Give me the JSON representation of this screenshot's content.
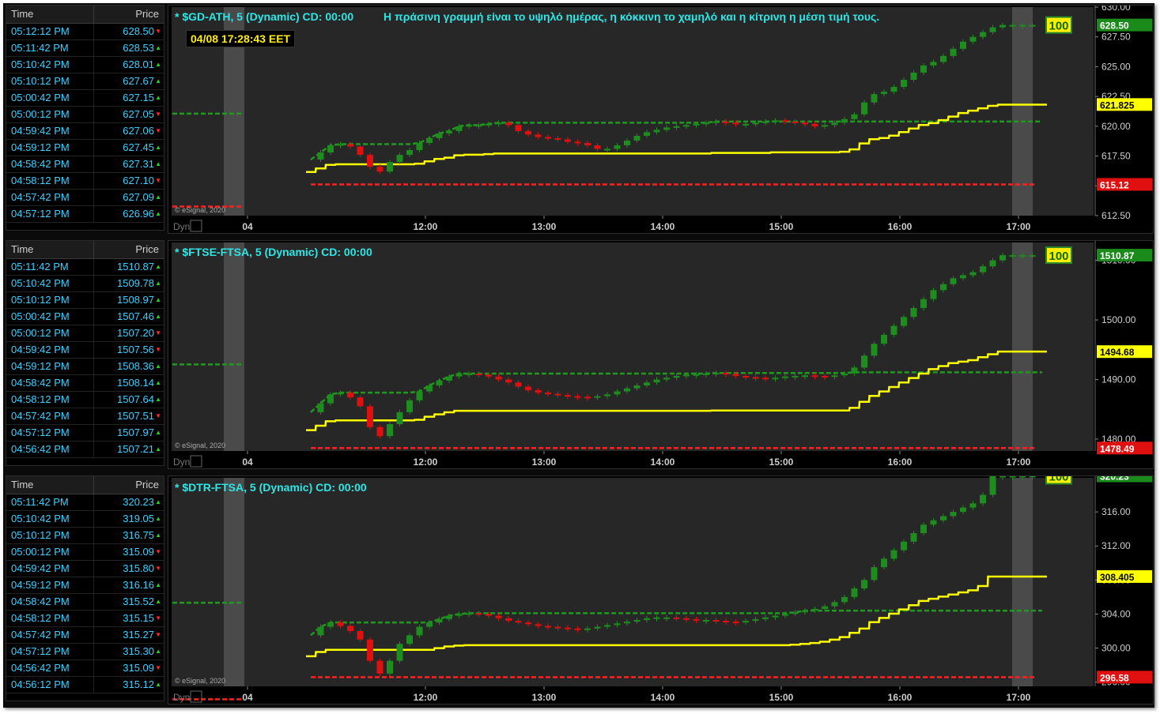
{
  "note": "Η πράσινη γραμμή είναι το υψηλό ημέρας, η κόκκινη το χαμηλό και η κίτρινη η μέση τιμή τους.",
  "clock": "04/08 17:28:43 EET",
  "common": {
    "time_header": "Time",
    "price_header": "Price",
    "watermark": "© eSignal, 2020",
    "dyn": "Dyn",
    "badge": "100",
    "x_ticks": [
      "04",
      "12:00",
      "13:00",
      "14:00",
      "15:00",
      "16:00",
      "17:00"
    ]
  },
  "colors": {
    "high": "#1f9a1f",
    "low": "#ff2020",
    "mid": "#ffff00",
    "up": "#1e8c1e",
    "down": "#e01010",
    "bg": "#272727"
  },
  "panels": [
    {
      "title": "* $GD-ATH, 5 (Dynamic) CD: 00:00",
      "ticks": [
        "612.50",
        "615.00",
        "617.50",
        "620.00",
        "622.50",
        "625.00",
        "627.50",
        "630.00"
      ],
      "price_tag": "628.50",
      "mid_tag": "621.825",
      "low_tag": "615.12",
      "trades": [
        [
          "05:12:12 PM",
          "628.50",
          "dn"
        ],
        [
          "05:11:42 PM",
          "628.53",
          "up"
        ],
        [
          "05:10:42 PM",
          "628.01",
          "up"
        ],
        [
          "05:10:12 PM",
          "627.67",
          "up"
        ],
        [
          "05:00:42 PM",
          "627.15",
          "up"
        ],
        [
          "05:00:12 PM",
          "627.05",
          "dn"
        ],
        [
          "04:59:42 PM",
          "627.06",
          "dn"
        ],
        [
          "04:59:12 PM",
          "627.45",
          "up"
        ],
        [
          "04:58:42 PM",
          "627.31",
          "up"
        ],
        [
          "04:58:12 PM",
          "627.10",
          "dn"
        ],
        [
          "04:57:42 PM",
          "627.09",
          "up"
        ],
        [
          "04:57:12 PM",
          "626.96",
          "up"
        ]
      ]
    },
    {
      "title": "* $FTSE-FTSA, 5 (Dynamic) CD: 00:00",
      "ticks": [
        "1480.00",
        "1490.00",
        "1500.00",
        "1510.00"
      ],
      "price_tag": "1510.87",
      "mid_tag": "1494.68",
      "low_tag": "1478.49",
      "trades": [
        [
          "05:11:42 PM",
          "1510.87",
          "up"
        ],
        [
          "05:10:42 PM",
          "1509.78",
          "up"
        ],
        [
          "05:10:12 PM",
          "1508.97",
          "up"
        ],
        [
          "05:00:42 PM",
          "1507.46",
          "up"
        ],
        [
          "05:00:12 PM",
          "1507.20",
          "dn"
        ],
        [
          "04:59:42 PM",
          "1507.56",
          "dn"
        ],
        [
          "04:59:12 PM",
          "1508.36",
          "up"
        ],
        [
          "04:58:42 PM",
          "1508.14",
          "up"
        ],
        [
          "04:58:12 PM",
          "1507.64",
          "up"
        ],
        [
          "04:57:42 PM",
          "1507.51",
          "dn"
        ],
        [
          "04:57:12 PM",
          "1507.97",
          "up"
        ],
        [
          "04:56:42 PM",
          "1507.21",
          "up"
        ]
      ]
    },
    {
      "title": "* $DTR-FTSA, 5 (Dynamic) CD: 00:00",
      "ticks": [
        "296.00",
        "300.00",
        "304.00",
        "308.00",
        "312.00",
        "316.00"
      ],
      "price_tag": "320.23",
      "mid_tag": "308.405",
      "low_tag": "296.58",
      "trades": [
        [
          "05:11:42 PM",
          "320.23",
          "up"
        ],
        [
          "05:10:42 PM",
          "319.05",
          "up"
        ],
        [
          "05:10:12 PM",
          "316.75",
          "up"
        ],
        [
          "05:00:12 PM",
          "315.09",
          "dn"
        ],
        [
          "04:59:42 PM",
          "315.80",
          "dn"
        ],
        [
          "04:59:12 PM",
          "316.16",
          "up"
        ],
        [
          "04:58:42 PM",
          "315.52",
          "up"
        ],
        [
          "04:58:12 PM",
          "315.15",
          "dn"
        ],
        [
          "04:57:42 PM",
          "315.27",
          "dn"
        ],
        [
          "04:57:12 PM",
          "315.30",
          "up"
        ],
        [
          "04:56:42 PM",
          "315.09",
          "dn"
        ],
        [
          "04:56:12 PM",
          "315.12",
          "up"
        ]
      ]
    }
  ],
  "chart_data": [
    {
      "type": "candlestick",
      "title": "* $GD-ATH, 5 (Dynamic) CD: 00:00",
      "x": [
        "11:00",
        "11:05",
        "11:10",
        "11:15",
        "11:20",
        "11:25",
        "11:30",
        "11:35",
        "11:40",
        "11:45",
        "11:50",
        "11:55",
        "12:00",
        "12:05",
        "12:10",
        "12:15",
        "12:20",
        "12:25",
        "12:30",
        "12:35",
        "12:40",
        "12:45",
        "12:50",
        "12:55",
        "13:00",
        "13:05",
        "13:10",
        "13:15",
        "13:20",
        "13:25",
        "13:30",
        "13:35",
        "13:40",
        "13:45",
        "13:50",
        "13:55",
        "14:00",
        "14:05",
        "14:10",
        "14:15",
        "14:20",
        "14:25",
        "14:30",
        "14:35",
        "14:40",
        "14:45",
        "14:50",
        "14:55",
        "15:00",
        "15:05",
        "15:10",
        "15:15",
        "15:20",
        "15:25",
        "15:30",
        "15:35",
        "15:40",
        "15:45",
        "15:50",
        "15:55",
        "16:00",
        "16:05",
        "16:10",
        "16:15",
        "16:20",
        "16:25",
        "16:30",
        "16:35",
        "16:40",
        "16:45",
        "16:50",
        "16:55",
        "17:00",
        "17:05",
        "17:10"
      ],
      "close": [
        617.2,
        617.8,
        618.4,
        618.5,
        618.3,
        617.6,
        616.6,
        616.2,
        617.0,
        617.6,
        618.0,
        618.6,
        619.0,
        619.4,
        619.6,
        620.0,
        620.1,
        620.1,
        620.2,
        620.3,
        620.1,
        619.6,
        619.3,
        619.1,
        619.0,
        618.9,
        618.7,
        618.6,
        618.4,
        618.1,
        618.1,
        618.4,
        618.8,
        619.2,
        619.5,
        619.7,
        619.9,
        620.0,
        620.1,
        620.2,
        620.3,
        620.4,
        620.3,
        620.2,
        620.2,
        620.3,
        620.4,
        620.5,
        620.4,
        620.3,
        620.2,
        620.0,
        620.1,
        620.3,
        620.6,
        621.0,
        622.0,
        622.7,
        622.9,
        623.3,
        623.9,
        624.5,
        625.1,
        625.4,
        625.9,
        626.5,
        627.1,
        627.5,
        627.9,
        628.3,
        628.5,
        628.5,
        628.5,
        628.5,
        628.5
      ],
      "day_high": 620.4,
      "day_low": 615.12,
      "day_mid": 621.825,
      "last": 628.5,
      "ylim": [
        612.5,
        630.0
      ]
    },
    {
      "type": "candlestick",
      "title": "* $FTSE-FTSA, 5 (Dynamic) CD: 00:00",
      "x": [
        "11:00",
        "11:05",
        "11:10",
        "11:15",
        "11:20",
        "11:25",
        "11:30",
        "11:35",
        "11:40",
        "11:45",
        "11:50",
        "11:55",
        "12:00",
        "12:05",
        "12:10",
        "12:15",
        "12:20",
        "12:25",
        "12:30",
        "12:35",
        "12:40",
        "12:45",
        "12:50",
        "12:55",
        "13:00",
        "13:05",
        "13:10",
        "13:15",
        "13:20",
        "13:25",
        "13:30",
        "13:35",
        "13:40",
        "13:45",
        "13:50",
        "13:55",
        "14:00",
        "14:05",
        "14:10",
        "14:15",
        "14:20",
        "14:25",
        "14:30",
        "14:35",
        "14:40",
        "14:45",
        "14:50",
        "14:55",
        "15:00",
        "15:05",
        "15:10",
        "15:15",
        "15:20",
        "15:25",
        "15:30",
        "15:35",
        "15:40",
        "15:45",
        "15:50",
        "15:55",
        "16:00",
        "16:05",
        "16:10",
        "16:15",
        "16:20",
        "16:25",
        "16:30",
        "16:35",
        "16:40",
        "16:45",
        "16:50",
        "16:55",
        "17:00",
        "17:05",
        "17:10"
      ],
      "close": [
        1484.5,
        1486.0,
        1487.5,
        1487.8,
        1487.0,
        1485.5,
        1482.0,
        1480.5,
        1482.5,
        1484.5,
        1486.5,
        1488.0,
        1489.0,
        1489.8,
        1490.5,
        1491.0,
        1491.0,
        1490.8,
        1490.5,
        1490.0,
        1489.5,
        1488.8,
        1488.2,
        1487.8,
        1487.6,
        1487.4,
        1487.2,
        1487.1,
        1487.0,
        1487.2,
        1487.5,
        1488.0,
        1488.5,
        1489.0,
        1489.5,
        1490.0,
        1490.3,
        1490.6,
        1490.8,
        1490.9,
        1491.0,
        1491.1,
        1490.9,
        1490.6,
        1490.4,
        1490.3,
        1490.2,
        1490.3,
        1490.5,
        1490.6,
        1490.7,
        1490.6,
        1490.5,
        1490.7,
        1491.0,
        1492.0,
        1494.0,
        1496.0,
        1497.5,
        1499.0,
        1500.5,
        1502.0,
        1503.5,
        1505.0,
        1506.0,
        1507.0,
        1507.5,
        1508.0,
        1509.0,
        1510.0,
        1510.87,
        1510.87,
        1510.87,
        1510.87,
        1510.87
      ],
      "day_high": 1491.2,
      "day_low": 1478.49,
      "day_mid": 1494.68,
      "last": 1510.87,
      "ylim": [
        1478.0,
        1513.0
      ]
    },
    {
      "type": "candlestick",
      "title": "* $DTR-FTSA, 5 (Dynamic) CD: 00:00",
      "x": [
        "11:00",
        "11:05",
        "11:10",
        "11:15",
        "11:20",
        "11:25",
        "11:30",
        "11:35",
        "11:40",
        "11:45",
        "11:50",
        "11:55",
        "12:00",
        "12:05",
        "12:10",
        "12:15",
        "12:20",
        "12:25",
        "12:30",
        "12:35",
        "12:40",
        "12:45",
        "12:50",
        "12:55",
        "13:00",
        "13:05",
        "13:10",
        "13:15",
        "13:20",
        "13:25",
        "13:30",
        "13:35",
        "13:40",
        "13:45",
        "13:50",
        "13:55",
        "14:00",
        "14:05",
        "14:10",
        "14:15",
        "14:20",
        "14:25",
        "14:30",
        "14:35",
        "14:40",
        "14:45",
        "14:50",
        "14:55",
        "15:00",
        "15:05",
        "15:10",
        "15:15",
        "15:20",
        "15:25",
        "15:30",
        "15:35",
        "15:40",
        "15:45",
        "15:50",
        "15:55",
        "16:00",
        "16:05",
        "16:10",
        "16:15",
        "16:20",
        "16:25",
        "16:30",
        "16:35",
        "16:40",
        "16:45",
        "16:50",
        "16:55",
        "17:00",
        "17:05",
        "17:10"
      ],
      "close": [
        301.5,
        302.5,
        303.0,
        302.6,
        302.0,
        301.0,
        298.5,
        297.0,
        298.5,
        300.5,
        301.5,
        302.5,
        303.0,
        303.4,
        303.8,
        304.0,
        304.1,
        304.0,
        303.8,
        303.5,
        303.2,
        303.0,
        302.8,
        302.6,
        302.5,
        302.4,
        302.3,
        302.2,
        302.3,
        302.5,
        302.7,
        302.9,
        303.1,
        303.3,
        303.5,
        303.6,
        303.6,
        303.5,
        303.4,
        303.3,
        303.3,
        303.2,
        303.1,
        303.0,
        303.2,
        303.4,
        303.6,
        303.8,
        304.0,
        304.2,
        304.4,
        304.6,
        304.9,
        305.4,
        306.0,
        307.0,
        308.0,
        309.5,
        310.5,
        311.5,
        312.5,
        313.5,
        314.5,
        315.0,
        315.5,
        316.0,
        316.5,
        317.0,
        318.0,
        320.23,
        320.23,
        320.23,
        320.23,
        320.23,
        320.23
      ],
      "day_high": 304.4,
      "day_low": 296.58,
      "day_mid": 308.405,
      "last": 320.23,
      "ylim": [
        295.5,
        320.0
      ]
    }
  ]
}
